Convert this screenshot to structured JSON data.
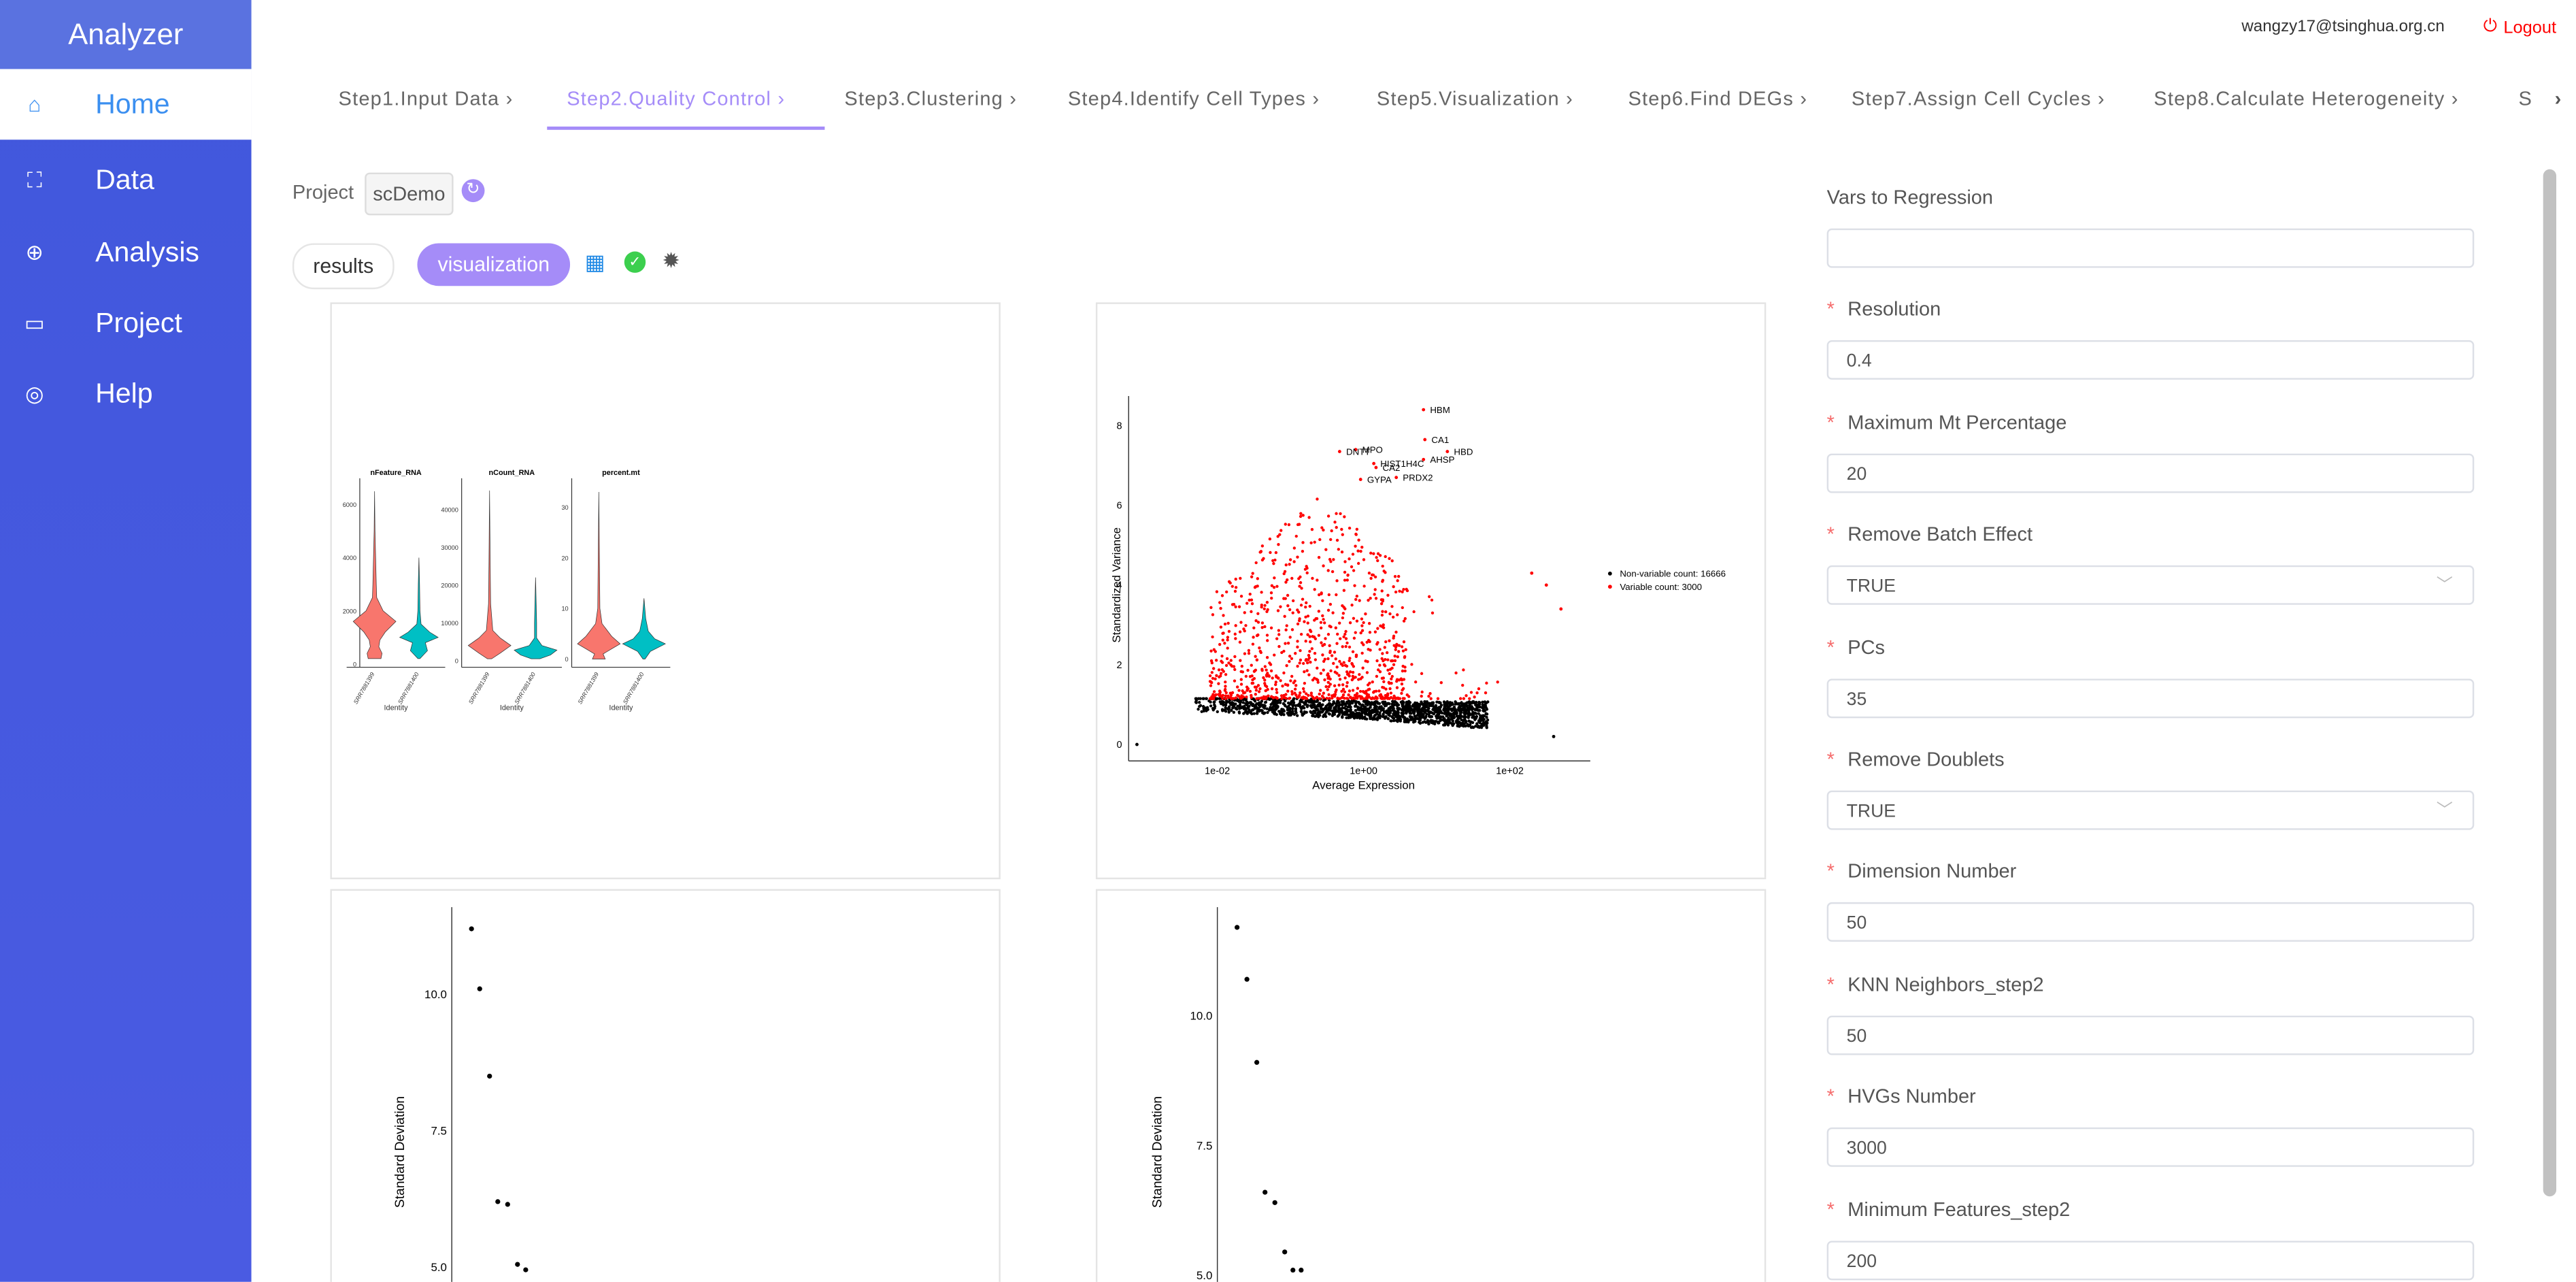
{
  "app": {
    "title": "Analyzer"
  },
  "sidebar": {
    "items": [
      {
        "label": "Home",
        "icon": "home-icon",
        "active": true
      },
      {
        "label": "Data",
        "icon": "presentation-chart-icon"
      },
      {
        "label": "Analysis",
        "icon": "crosshair-icon"
      },
      {
        "label": "Project",
        "icon": "folder-icon"
      },
      {
        "label": "Help",
        "icon": "lifebuoy-icon"
      }
    ]
  },
  "header": {
    "user": "wangzy17@tsinghua.org.cn",
    "logout": "Logout"
  },
  "steps": [
    {
      "label": "Step1.Input Data"
    },
    {
      "label": "Step2.Quality Control",
      "active": true
    },
    {
      "label": "Step3.Clustering"
    },
    {
      "label": "Step4.Identify Cell Types"
    },
    {
      "label": "Step5.Visualization"
    },
    {
      "label": "Step6.Find DEGs"
    },
    {
      "label": "Step7.Assign Cell Cycles"
    },
    {
      "label": "Step8.Calculate Heterogeneity"
    },
    {
      "label": "S"
    }
  ],
  "project": {
    "label": "Project",
    "value": "scDemo"
  },
  "views": {
    "results": "results",
    "visualization": "visualization",
    "active": "visualization"
  },
  "colors": {
    "accent": "#a58cf8",
    "sidebar": "#4157dc",
    "home_active": "#3b8ff0",
    "logout": "#ff0000",
    "violin_a": "#f8766d",
    "violin_b": "#00bfc4",
    "variable": "#ff0000",
    "nonvariable": "#000000"
  },
  "form": {
    "fields": [
      {
        "label": "Vars to Regression",
        "value": "",
        "required": false
      },
      {
        "label": "Resolution",
        "value": "0.4",
        "required": true
      },
      {
        "label": "Maximum Mt Percentage",
        "value": "20",
        "required": true
      },
      {
        "label": "Remove Batch Effect",
        "value": "TRUE",
        "required": true,
        "type": "select"
      },
      {
        "label": "PCs",
        "value": "35",
        "required": true
      },
      {
        "label": "Remove Doublets",
        "value": "TRUE",
        "required": true,
        "type": "select"
      },
      {
        "label": "Dimension Number",
        "value": "50",
        "required": true
      },
      {
        "label": "KNN Neighbors_step2",
        "value": "50",
        "required": true
      },
      {
        "label": "HVGs Number",
        "value": "3000",
        "required": true
      },
      {
        "label": "Minimum Features_step2",
        "value": "200",
        "required": true
      }
    ]
  },
  "chart_data": [
    {
      "type": "violin",
      "xlabel": "Identity",
      "categories": [
        "SRR7881399",
        "SRR7881400"
      ],
      "panels": [
        {
          "title": "nFeature_RNA",
          "yticks": [
            "0",
            "2000",
            "4000",
            "6000"
          ],
          "ylim": [
            0,
            6500
          ],
          "ranges": [
            [
              200,
              6500
            ],
            [
              200,
              4000
            ]
          ]
        },
        {
          "title": "nCount_RNA",
          "yticks": [
            "0",
            "10000",
            "20000",
            "30000",
            "40000"
          ],
          "ylim": [
            0,
            45000
          ],
          "ranges": [
            [
              500,
              45000
            ],
            [
              500,
              22000
            ]
          ]
        },
        {
          "title": "percent.mt",
          "yticks": [
            "0",
            "10",
            "20",
            "30"
          ],
          "ylim": [
            0,
            33
          ],
          "ranges": [
            [
              0,
              33
            ],
            [
              0,
              12
            ]
          ]
        }
      ]
    },
    {
      "type": "scatter",
      "xlabel": "Average Expression",
      "ylabel": "Standardized Variance",
      "xscale": "log10",
      "xticks": [
        "1e-02",
        "1e+00",
        "1e+02"
      ],
      "yticks": [
        "0",
        "2",
        "4",
        "6",
        "8"
      ],
      "xlim": [
        0.0006,
        1300
      ],
      "ylim": [
        -0.3,
        8.8
      ],
      "legend": {
        "position": "right",
        "entries": [
          "Non-variable count: 16666",
          "Variable count: 3000"
        ]
      },
      "labeled_points": [
        {
          "gene": "HBM",
          "x": 6.6,
          "y": 8.4
        },
        {
          "gene": "CA1",
          "x": 6.9,
          "y": 7.65
        },
        {
          "gene": "HBD",
          "x": 14,
          "y": 7.35
        },
        {
          "gene": "AHSP",
          "x": 6.6,
          "y": 7.15
        },
        {
          "gene": "MPO",
          "x": 0.78,
          "y": 7.4
        },
        {
          "gene": "DNTT",
          "x": 0.47,
          "y": 7.35
        },
        {
          "gene": "HIST1H4C",
          "x": 1.38,
          "y": 7.05
        },
        {
          "gene": "CA2",
          "x": 1.48,
          "y": 6.95
        },
        {
          "gene": "GYPA",
          "x": 0.91,
          "y": 6.65
        },
        {
          "gene": "PRDX2",
          "x": 2.8,
          "y": 6.7
        }
      ]
    },
    {
      "type": "scatter",
      "ylabel": "Standard Deviation",
      "yticks": [
        "5.0",
        "7.5",
        "10.0"
      ],
      "values": [
        11.2,
        10.1,
        8.5,
        6.2,
        6.15,
        5.05,
        4.95
      ]
    },
    {
      "type": "scatter",
      "ylabel": "Standard Deviation",
      "yticks": [
        "5.0",
        "7.5",
        "10.0"
      ],
      "values": [
        11.7,
        10.7,
        9.1,
        6.6,
        6.4,
        5.45,
        5.1,
        5.1
      ]
    }
  ]
}
